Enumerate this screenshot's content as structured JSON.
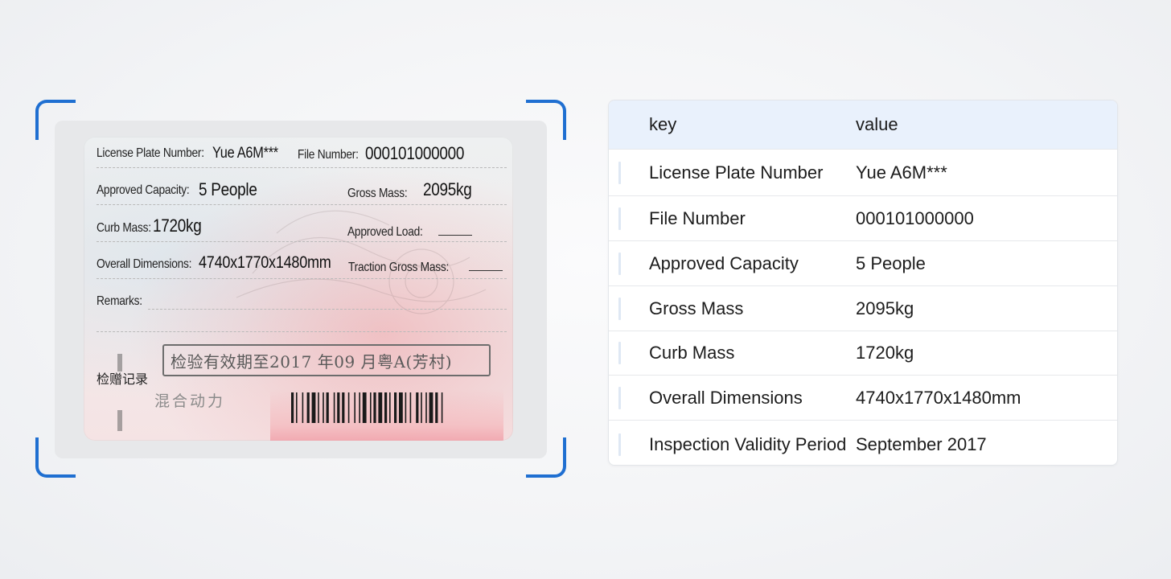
{
  "document": {
    "license_plate_label": "License Plate Number:",
    "license_plate_value": "Yue A6M***",
    "file_number_label": "File Number:",
    "file_number_value": "000101000000",
    "approved_capacity_label": "Approved Capacity:",
    "approved_capacity_value": "5 People",
    "gross_mass_label": "Gross Mass:",
    "gross_mass_value": "2095kg",
    "curb_mass_label": "Curb Mass:",
    "curb_mass_value": "1720kg",
    "approved_load_label": "Approved Load:",
    "overall_dimensions_label": "Overall Dimensions:",
    "overall_dimensions_value": "4740x1770x1480mm",
    "traction_gross_mass_label": "Traction Gross Mass:",
    "remarks_label": "Remarks:",
    "inspection_record_label": "检赠记录",
    "inspection_stamp": "检验有效期至2017 年09 月粤A(芳村)",
    "hybrid_label": "混合动力"
  },
  "table": {
    "header": {
      "key": "key",
      "value": "value"
    },
    "rows": [
      {
        "key": "License Plate Number",
        "value": "Yue A6M***"
      },
      {
        "key": "File Number",
        "value": "000101000000"
      },
      {
        "key": "Approved Capacity",
        "value": "5 People"
      },
      {
        "key": "Gross Mass",
        "value": "2095kg"
      },
      {
        "key": "Curb Mass",
        "value": "1720kg"
      },
      {
        "key": "Overall Dimensions",
        "value": "4740x1770x1480mm"
      },
      {
        "key": "Inspection Validity Period",
        "value": "September 2017"
      }
    ]
  },
  "colors": {
    "scan_corner": "#1f6fd1",
    "table_header_bg": "#e9f1fc"
  }
}
